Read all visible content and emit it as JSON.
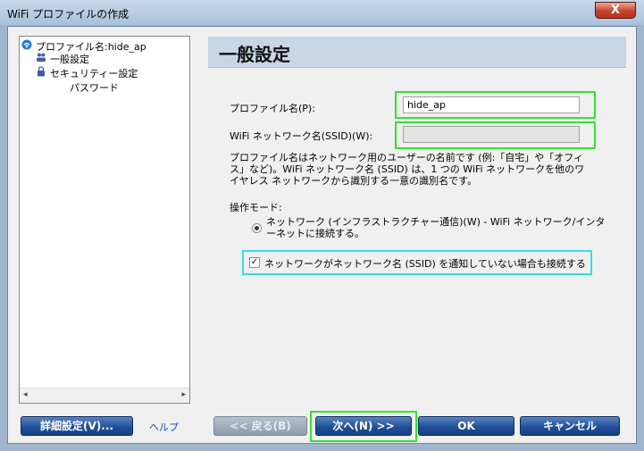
{
  "window": {
    "title": "WiFi プロファイルの作成",
    "close_glyph": "X"
  },
  "tree": {
    "items": [
      {
        "label": "プロファイル名:hide_ap",
        "icon": "wifi-icon"
      },
      {
        "label": "一般設定",
        "icon": "users-icon"
      },
      {
        "label": "セキュリティー設定",
        "icon": "lock-icon"
      },
      {
        "label": "パスワード",
        "icon": ""
      }
    ],
    "scroll_left": "◂",
    "scroll_right": "▸"
  },
  "header": {
    "title": "一般設定"
  },
  "form": {
    "profile_name_label": "プロファイル名(P):",
    "profile_name_value": "hide_ap",
    "ssid_label": "WiFi ネットワーク名(SSID)(W):",
    "ssid_value": "",
    "description": "プロファイル名はネットワーク用のユーザーの名前です (例:「自宅」や「オフィス」など)。WiFi ネットワーク名 (SSID) は、1 つの WiFi ネットワークを他のワイヤレス ネットワークから識別する一意の識別名です。",
    "mode_label": "操作モード:",
    "mode_option": "ネットワーク (インフラストラクチャー通信)(W) - WiFi ネットワーク/インターネットに接続する。",
    "broadcast_checkbox": "ネットワークがネットワーク名 (SSID) を通知していない場合も接続する",
    "broadcast_checked": true
  },
  "buttons": {
    "advanced": "詳細設定(V)...",
    "help": "ヘルプ",
    "back": "<< 戻る(B)",
    "next": "次へ(N) >>",
    "ok": "OK",
    "cancel": "キャンセル"
  },
  "colors": {
    "accent": "#1e4d96",
    "highlight_green": "#35e035",
    "highlight_cyan": "#32e0e0"
  }
}
